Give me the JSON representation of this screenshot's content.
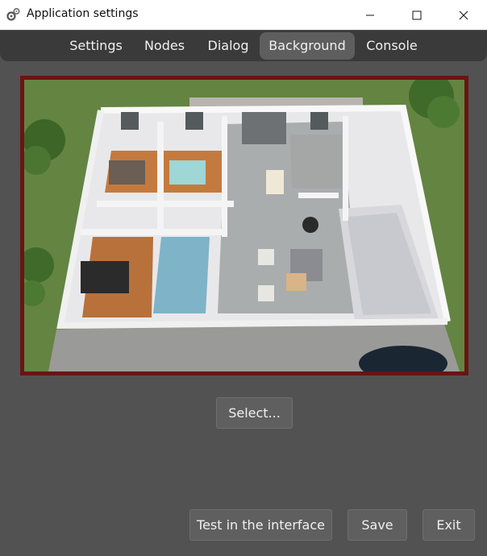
{
  "window": {
    "title": "Application settings",
    "icon": "gears-icon"
  },
  "tabs": [
    {
      "label": "Settings",
      "active": false
    },
    {
      "label": "Nodes",
      "active": false
    },
    {
      "label": "Dialog",
      "active": false
    },
    {
      "label": "Background",
      "active": true
    },
    {
      "label": "Console",
      "active": false
    }
  ],
  "preview": {
    "description_icon": "floorplan-image",
    "border_color": "#6a1414"
  },
  "buttons": {
    "select": "Select...",
    "test": "Test in the interface",
    "save": "Save",
    "exit": "Exit"
  },
  "colors": {
    "background": "#525252",
    "tabbar": "#3a3a3a",
    "active_tab": "#5e5e5e",
    "button": "#5f5f5f"
  }
}
